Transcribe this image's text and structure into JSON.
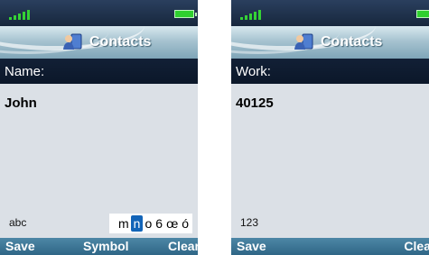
{
  "colors": {
    "signal": "#35d235",
    "battery": "#2fd02f",
    "highlight": "#1264b8",
    "softkey_bar": "#3a7494"
  },
  "screens": [
    {
      "title": "Contacts",
      "title_icon": "contacts-icon",
      "field_label": "Name:",
      "field_value": "John",
      "input_mode": "abc",
      "char_picker": [
        "m",
        "n",
        "o",
        "6",
        "œ",
        "ó"
      ],
      "selected_char": "n",
      "softkeys": {
        "left": "Save",
        "middle": "Symbol",
        "right": "Clear"
      }
    },
    {
      "title": "Contacts",
      "title_icon": "contacts-icon",
      "field_label": "Work:",
      "field_value": "40125",
      "input_mode": "123",
      "softkeys": {
        "left": "Save",
        "right": "Clea"
      }
    }
  ]
}
